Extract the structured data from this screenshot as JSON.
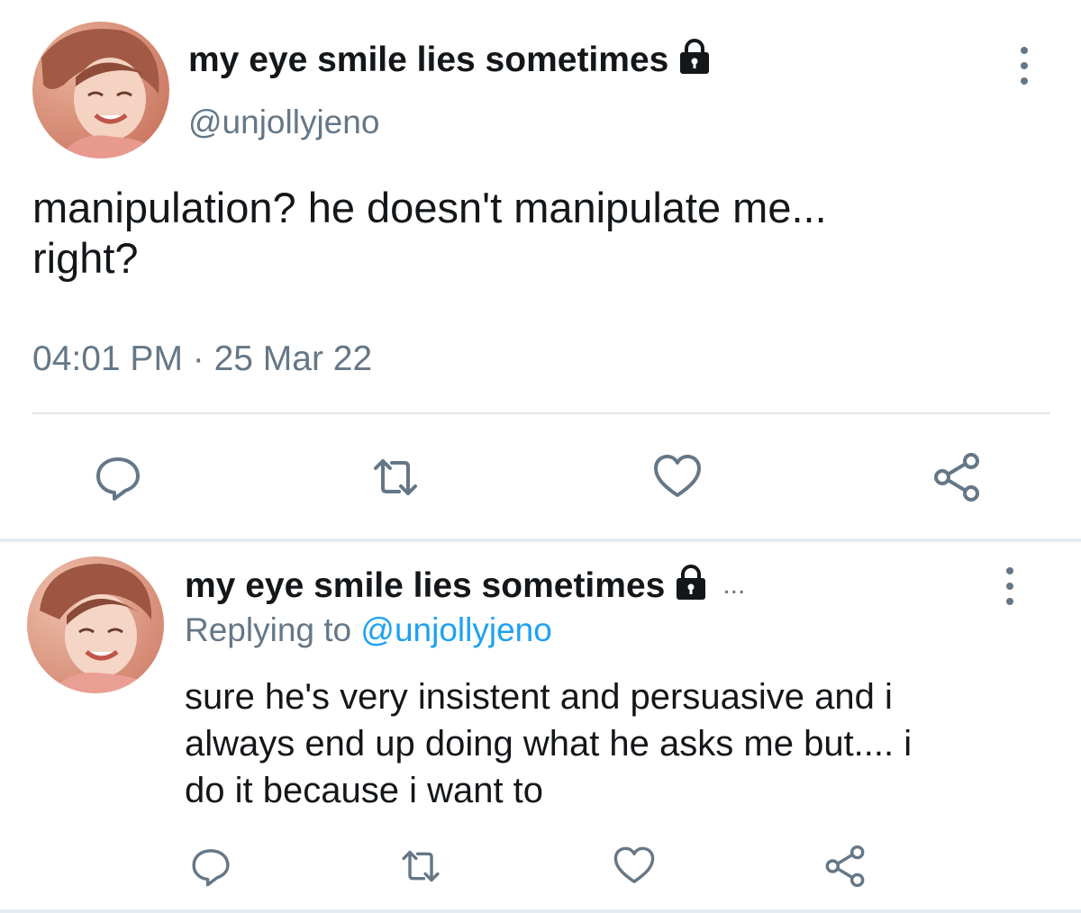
{
  "main_tweet": {
    "display_name": "my eye smile lies sometimes",
    "handle": "@unjollyjeno",
    "text_line1": "manipulation? he doesn't manipulate me...",
    "text_line2": "right?",
    "timestamp": "04:01 PM · 25 Mar 22",
    "protected_icon": "lock-icon",
    "menu_icon": "more-vertical-icon",
    "actions": [
      "reply-icon",
      "retweet-icon",
      "like-icon",
      "share-icon"
    ]
  },
  "reply_tweet": {
    "display_name": "my eye smile lies sometimes",
    "truncation": "...",
    "replying_prefix": "Replying to",
    "replying_handle": "@unjollyjeno",
    "text_line1": "sure he's very insistent and persuasive and i",
    "text_line2": "always end up doing what he asks me but.... i",
    "text_line3": "do it because i want to",
    "protected_icon": "lock-icon",
    "menu_icon": "more-vertical-icon",
    "actions": [
      "reply-icon",
      "retweet-icon",
      "like-icon",
      "share-icon"
    ]
  },
  "colors": {
    "text_primary": "#14171a",
    "text_secondary": "#657786",
    "link": "#1da1f2",
    "divider": "#e1e8ed",
    "icon": "#657786"
  }
}
